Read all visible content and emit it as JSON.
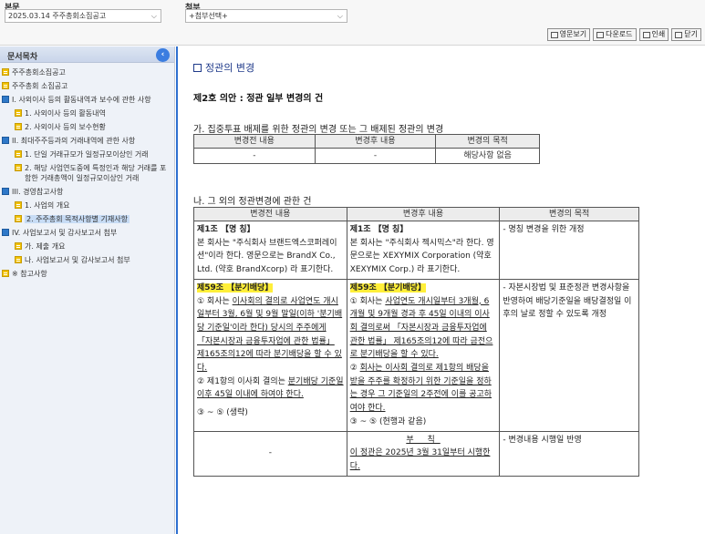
{
  "header": {
    "main_label": "본문",
    "main_select": "2025.03.14  주주총회소집공고",
    "attach_label": "첨부",
    "attach_select": "+첨부선택+",
    "buttons": [
      "영문보기",
      "다운로드",
      "인쇄",
      "닫기"
    ]
  },
  "sidebar": {
    "title": "문서목차",
    "collapse_glyph": "‹",
    "items": [
      {
        "label": "주주총회소집공고",
        "level": 1,
        "icon": "doc-icon"
      },
      {
        "label": "주주총회 소집공고",
        "level": 1,
        "icon": "doc-icon"
      },
      {
        "label": "I. 사외이사 등의 활동내역과 보수에 관한 사항",
        "level": 1,
        "icon": "folder-icon"
      },
      {
        "label": "1. 사외이사 등의 활동내역",
        "level": 2,
        "icon": "doc-icon"
      },
      {
        "label": "2. 사외이사 등의 보수현황",
        "level": 2,
        "icon": "doc-icon"
      },
      {
        "label": "II. 최대주주등과의 거래내역에 관한 사항",
        "level": 1,
        "icon": "folder-icon"
      },
      {
        "label": "1. 단일 거래규모가 일정규모이상인 거래",
        "level": 2,
        "icon": "doc-icon"
      },
      {
        "label": "2. 해당 사업연도중에 특정인과 해당 거래를 포함한 거래총액이 일정규모이상인 거래",
        "level": 2,
        "icon": "doc-icon"
      },
      {
        "label": "III. 경영참고사항",
        "level": 1,
        "icon": "folder-icon"
      },
      {
        "label": "1. 사업의 개요",
        "level": 2,
        "icon": "doc-icon"
      },
      {
        "label": "2. 주주총회 목적사항별 기재사항",
        "level": 2,
        "icon": "doc-icon",
        "selected": true
      },
      {
        "label": "IV. 사업보고서 및 감사보고서 첨부",
        "level": 1,
        "icon": "folder-icon"
      },
      {
        "label": "가. 제출 개요",
        "level": 2,
        "icon": "doc-icon"
      },
      {
        "label": "나. 사업보고서 및 감사보고서 첨부",
        "level": 2,
        "icon": "doc-icon"
      },
      {
        "label": "※ 참고사항",
        "level": 1,
        "icon": "doc-icon"
      }
    ]
  },
  "document": {
    "heading": "정관의 변경",
    "agenda": "제2호 의안 : 정관 일부 변경의 건",
    "section_a": "가. 집중투표 배제를 위한 정관의 변경 또는 그 배제된 정관의 변경",
    "table_a": {
      "headers": [
        "변경전 내용",
        "변경후 내용",
        "변경의 목적"
      ],
      "row": [
        "-",
        "-",
        "해당사항 없음"
      ]
    },
    "section_b": "나. 그 외의 정관변경에 관한 건",
    "table_b": {
      "headers": [
        "변경전 내용",
        "변경후 내용",
        "변경의 목적"
      ],
      "row1": {
        "before_title": "제1조 【명 칭】",
        "before_body": "본 회사는 \"주식회사 브랜드엑스코퍼레이션\"이라 한다. 영문으로는 BrandX Co., Ltd. (약호 BrandXcorp) 라 표기한다.",
        "after_title": "제1조 【명 칭】",
        "after_body": "본 회사는 \"주식회사 젝시믹스\"라 한다. 영문으로는 XEXYMIX Corporation (약호 XEXYMIX Corp.) 라 표기한다.",
        "purpose": "- 명칭 변경을 위한 개정"
      },
      "row2": {
        "before_title": "제59조 【분기배당】",
        "before_p1_pre": "① 회사는 ",
        "before_p1_u": "이사회의 결의로 사업연도 개시일부터 3월, 6월 및 9월 말일(이하 '분기배당 기준일'이라 한다) 당시의 주주에게 「자본시장과 금융투자업에 관한 법률」 제165조의12에 따라 분기배당을 할 수 있다.",
        "before_p2_pre": "② 제1항의 이사회 결의는 ",
        "before_p2_u": "분기배당 기준일 이후 45일 이내에 하여야 한다.",
        "before_p3": "③ ~ ⑤ (생략)",
        "after_title": "제59조 【분기배당】",
        "after_p1_pre": "① 회사는 ",
        "after_p1_u": "사업연도 개시일부터 3개월, 6개월 및 9개월 경과 후 45일 이내의 이사회 결의로써 「자본시장과 금융투자업에 관한 법률」 제165조의12에 따라 금전으로 분기배당을 할 수 있다.",
        "after_p2_pre": "② ",
        "after_p2_u": "회사는 이사회 결의로 제1항의 배당을 받을 주주를 확정하기 위한 기준일을 정하는 경우 그 기준일의 2주전에 이를 공고하여야 한다.",
        "after_p3": "③ ~ ⑤ (현행과 같음)",
        "purpose": "- 자본시장법 및 표준정관 변경사항을 반영하여 배당기준일을 배당결정일 이후의 날로 정할 수 있도록 개정"
      },
      "row3": {
        "before": "-",
        "after_title": "부 칙",
        "after_body": "이 정관은 2025년 3월 31일부터 시행한다.",
        "purpose": "- 변경내용 시행일 반영"
      }
    }
  }
}
